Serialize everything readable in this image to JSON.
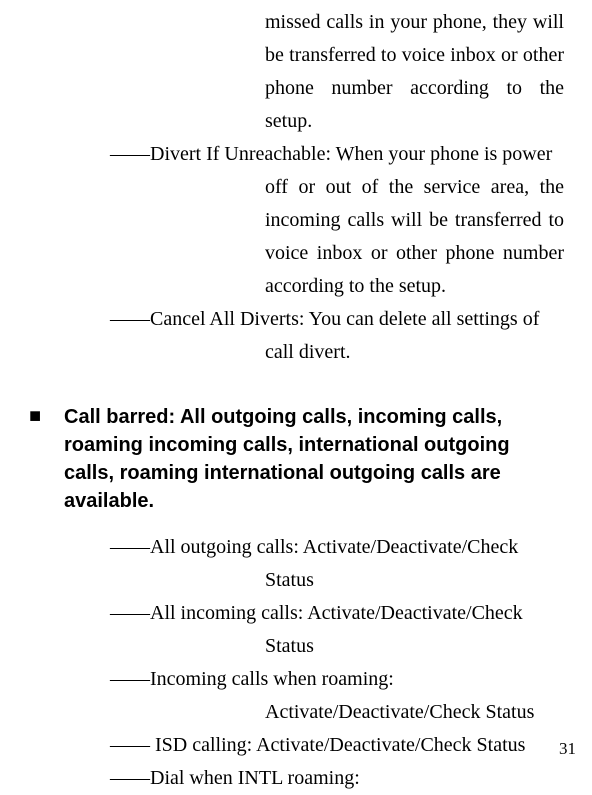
{
  "entries_top": [
    {
      "cls": "entry entry-cont",
      "text": "missed calls in your phone, they will be transferred to voice inbox or other phone number according to the setup."
    },
    {
      "cls": "entry entry-start",
      "text": "――Divert If Unreachable: When your phone is power"
    },
    {
      "cls": "entry entry-cont",
      "text": "off or out of the service area, the incoming calls will be transferred to voice inbox or other phone number according to the setup."
    },
    {
      "cls": "entry entry-start",
      "text": "――Cancel All Diverts: You can delete all settings of"
    },
    {
      "cls": "entry entry-cont",
      "text": "call divert."
    }
  ],
  "heading": "Call barred: All outgoing calls, incoming calls, roaming incoming calls, international outgoing calls, roaming international outgoing calls are available.",
  "entries_bottom": [
    {
      "cls": "entry entry-start",
      "text": "――All outgoing calls: Activate/Deactivate/Check"
    },
    {
      "cls": "entry entry-cont",
      "text": "Status"
    },
    {
      "cls": "entry entry-start",
      "text": "――All incoming calls: Activate/Deactivate/Check"
    },
    {
      "cls": "entry entry-cont",
      "text": "Status"
    },
    {
      "cls": "entry entry-start",
      "text": "――Incoming calls when roaming:"
    },
    {
      "cls": "entry entry-cont",
      "text": "Activate/Deactivate/Check Status"
    },
    {
      "cls": "entry entry-start",
      "text": "―― ISD calling: Activate/Deactivate/Check Status"
    },
    {
      "cls": "entry entry-start",
      "text": "――Dial when INTL roaming:"
    }
  ],
  "page_number": "31",
  "bullet": "■"
}
